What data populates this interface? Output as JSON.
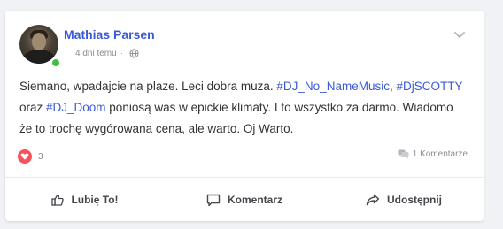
{
  "post": {
    "author": "Mathias Parsen",
    "time": "4 dni temu",
    "separator": "·",
    "privacy_icon": "globe-icon",
    "text": {
      "part1": "Siemano, wpadajcie na plaze. Leci dobra muza. ",
      "tag1": "#DJ_No_NameMusic",
      "part2": ", ",
      "tag2": "#DjSCOTTY",
      "part3": " oraz ",
      "tag3": "#DJ_Doom",
      "part4": " poniosą was w epickie klimaty. I to wszystko za darmo. Wiadomo że to trochę wygórowana cena, ale warto. Oj Warto."
    },
    "reactions": {
      "icon": "heart-icon",
      "count": "3"
    },
    "comments_count": "1 Komentarze",
    "actions": {
      "like": "Lubię To!",
      "comment": "Komentarz",
      "share": "Udostępnij"
    }
  },
  "colors": {
    "accent": "#3b5bd6",
    "online": "#3ec03e",
    "heart": "#f5535b",
    "text": "#333333",
    "muted": "#8a8d91"
  }
}
